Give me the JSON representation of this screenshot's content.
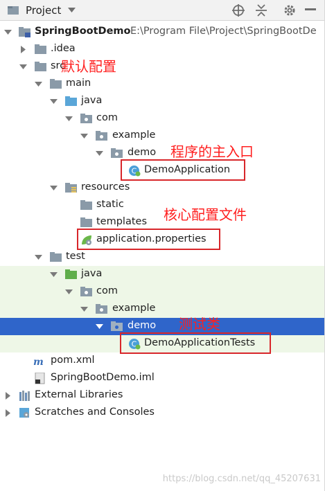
{
  "header": {
    "title": "Project",
    "icons": [
      "project-window-icon",
      "dropdown-icon",
      "locate-icon",
      "collapse-all-icon",
      "settings-gear-icon",
      "hide-panel-icon"
    ]
  },
  "tree": {
    "root_name": "SpringBootDemo",
    "root_path": "E:\\Program File\\Project\\SpringBootDe",
    "idea": ".idea",
    "src": "src",
    "main": "main",
    "java_main": "java",
    "com_main": "com",
    "example_main": "example",
    "demo_main": "demo",
    "app_class": "DemoApplication",
    "resources": "resources",
    "static": "static",
    "templates": "templates",
    "properties": "application.properties",
    "test": "test",
    "java_test": "java",
    "com_test": "com",
    "example_test": "example",
    "demo_test": "demo",
    "test_class": "DemoApplicationTests",
    "pom": "pom.xml",
    "iml": "SpringBootDemo.iml",
    "external_libs": "External Libraries",
    "scratches": "Scratches and Consoles"
  },
  "annotations": {
    "default_config": "默认配置",
    "main_entry": "程序的主入口",
    "core_config": "核心配置文件",
    "test_class": "测试类"
  },
  "watermark": "https://blog.csdn.net/qq_45207631",
  "colors": {
    "selection": "#2f65ca",
    "test_background": "#eef7e7",
    "annotation": "#ff1f1f",
    "folder": "#8a9aa8",
    "source_folder": "#5aa6d8",
    "test_folder": "#5fae4a"
  }
}
